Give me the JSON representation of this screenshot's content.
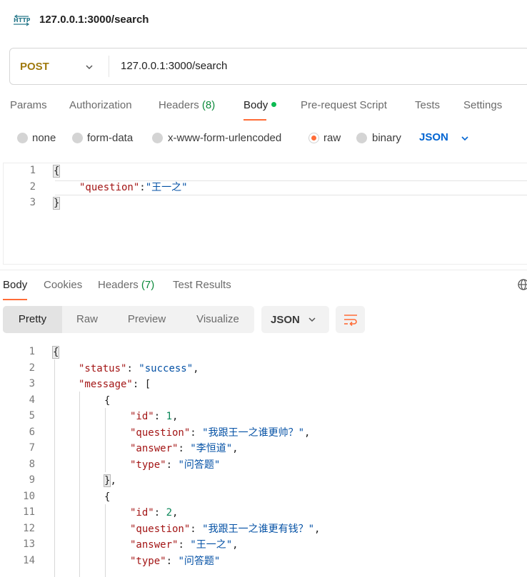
{
  "header": {
    "icon": "http-icon",
    "title": "127.0.0.1:3000/search"
  },
  "request": {
    "method": "POST",
    "url": "127.0.0.1:3000/search",
    "tabs": {
      "params": "Params",
      "authorization": "Authorization",
      "headers": "Headers",
      "headers_count": "(8)",
      "body": "Body",
      "prerequest": "Pre-request Script",
      "tests": "Tests",
      "settings": "Settings"
    },
    "body_types": {
      "none": "none",
      "form_data": "form-data",
      "urlencoded": "x-www-form-urlencoded",
      "raw": "raw",
      "binary": "binary",
      "selected": "raw"
    },
    "raw_format": "JSON",
    "body_lines": {
      "l1": {
        "num": "1",
        "open": "{"
      },
      "l2": {
        "num": "2",
        "key": "\"question\"",
        "colon": ":",
        "value": "\"王一之\""
      },
      "l3": {
        "num": "3",
        "close": "}"
      }
    }
  },
  "response": {
    "tabs": {
      "body": "Body",
      "cookies": "Cookies",
      "headers": "Headers",
      "headers_count": "(7)",
      "test_results": "Test Results"
    },
    "views": {
      "pretty": "Pretty",
      "raw": "Raw",
      "preview": "Preview",
      "visualize": "Visualize",
      "selected": "Pretty"
    },
    "format": "JSON",
    "lines": {
      "l1": {
        "num": "1",
        "text": "{"
      },
      "l2": {
        "num": "2",
        "key": "\"status\"",
        "sep": ": ",
        "value": "\"success\"",
        "tail": ","
      },
      "l3": {
        "num": "3",
        "key": "\"message\"",
        "sep": ": ",
        "tail": "["
      },
      "l4": {
        "num": "4",
        "text": "{"
      },
      "l5": {
        "num": "5",
        "key": "\"id\"",
        "sep": ": ",
        "value": "1",
        "tail": ","
      },
      "l6": {
        "num": "6",
        "key": "\"question\"",
        "sep": ": ",
        "value": "\"我跟王一之谁更帅？\"",
        "tail": ","
      },
      "l7": {
        "num": "7",
        "key": "\"answer\"",
        "sep": ": ",
        "value": "\"李恒道\"",
        "tail": ","
      },
      "l8": {
        "num": "8",
        "key": "\"type\"",
        "sep": ": ",
        "value": "\"问答题\""
      },
      "l9": {
        "num": "9",
        "text": "}",
        "tail": ","
      },
      "l10": {
        "num": "10",
        "text": "{"
      },
      "l11": {
        "num": "11",
        "key": "\"id\"",
        "sep": ": ",
        "value": "2",
        "tail": ","
      },
      "l12": {
        "num": "12",
        "key": "\"question\"",
        "sep": ": ",
        "value": "\"我跟王一之谁更有钱？\"",
        "tail": ","
      },
      "l13": {
        "num": "13",
        "key": "\"answer\"",
        "sep": ": ",
        "value": "\"王一之\"",
        "tail": ","
      },
      "l14": {
        "num": "14",
        "key": "\"type\"",
        "sep": ": ",
        "value": "\"问答题\""
      }
    }
  },
  "colors": {
    "accent": "#ff6c37",
    "method": "#a07a0e",
    "json_link": "#0265d2",
    "count_green": "#0c8a3b",
    "dot_green": "#0cbb52"
  }
}
